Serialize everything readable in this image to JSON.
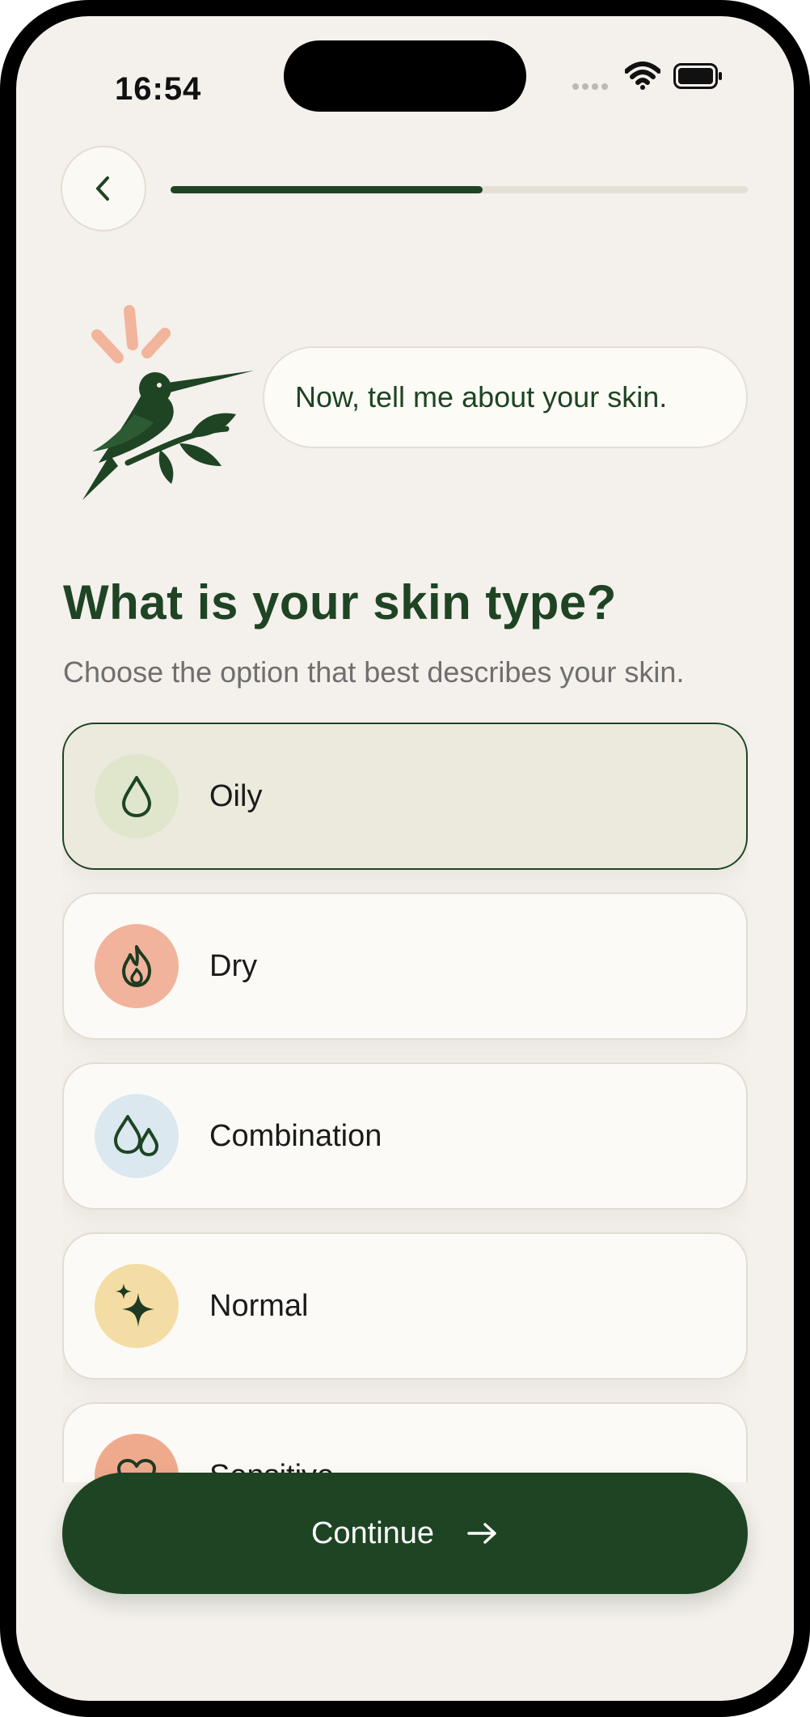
{
  "status_bar": {
    "time": "16:54"
  },
  "nav": {
    "progress": 0.54
  },
  "mascot": {
    "message": "Now, tell me about your skin."
  },
  "question": {
    "title": "What is your skin type?",
    "subtitle": "Choose the option that best describes your skin."
  },
  "options": [
    {
      "label": "Oily",
      "icon": "oil-drop-icon",
      "icon_bg": "#dfe6cc",
      "selected": true
    },
    {
      "label": "Dry",
      "icon": "flame-icon",
      "icon_bg": "#f1b39b",
      "selected": false
    },
    {
      "label": "Combination",
      "icon": "two-drops-icon",
      "icon_bg": "#dbe8f0",
      "selected": false
    },
    {
      "label": "Normal",
      "icon": "sparkle-icon",
      "icon_bg": "#f3dda4",
      "selected": false
    },
    {
      "label": "Sensitive",
      "icon": "heart-icon",
      "icon_bg": "#efaa8e",
      "selected": false
    }
  ],
  "continue_button": {
    "label": "Continue"
  },
  "colors": {
    "brand": "#1e4424",
    "background": "#f4f0eb",
    "card": "#fcfaf6",
    "selected_card": "#eceadd"
  }
}
